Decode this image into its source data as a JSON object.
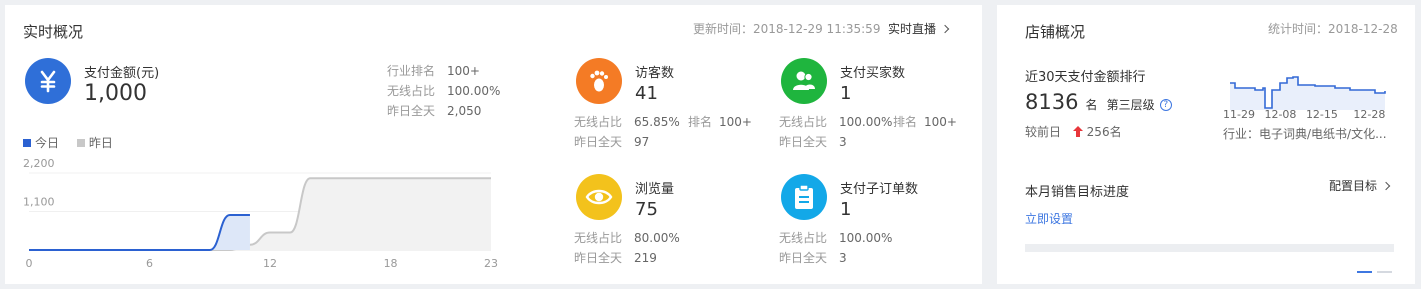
{
  "realtime": {
    "title": "实时概况",
    "update_time": "更新时间：2018-12-29 11:35:59",
    "live_link": "实时直播",
    "payment": {
      "label": "支付金额(元)",
      "value": "1,000",
      "icon": "yuan-icon",
      "color": "#2f6fd8",
      "stats": [
        {
          "label": "行业排名",
          "value": "100+"
        },
        {
          "label": "无线占比",
          "value": "100.00%"
        },
        {
          "label": "昨日全天",
          "value": "2,050"
        }
      ]
    },
    "legend": {
      "today": "今日",
      "yesterday": "昨日",
      "today_color": "#2b61d1",
      "yesterday_color": "#c8c8c8"
    },
    "chart_data": {
      "type": "line",
      "x": [
        0,
        1,
        2,
        3,
        4,
        5,
        6,
        7,
        8,
        9,
        10,
        11,
        12,
        13,
        14,
        15,
        16,
        17,
        18,
        19,
        20,
        21,
        22,
        23
      ],
      "series": [
        {
          "name": "今日",
          "values": [
            0,
            0,
            0,
            0,
            0,
            0,
            0,
            0,
            0,
            0,
            1000,
            1000
          ]
        },
        {
          "name": "昨日",
          "values": [
            0,
            0,
            0,
            0,
            0,
            0,
            0,
            0,
            0,
            0,
            0,
            150,
            500,
            500,
            2050,
            2050,
            2050,
            2050,
            2050,
            2050,
            2050,
            2050,
            2050,
            2050
          ]
        }
      ],
      "yticks": [
        "2,200",
        "1,100"
      ],
      "xticks": [
        "0",
        "6",
        "12",
        "18",
        "23"
      ],
      "ylim": [
        0,
        2200
      ],
      "xlim": [
        0,
        23
      ]
    },
    "visitors": {
      "label": "访客数",
      "value": "41",
      "icon": "footprint-icon",
      "color": "#f47b25",
      "row1": {
        "l1": "无线占比",
        "v1": "65.85%",
        "l2": "排名",
        "v2": "100+"
      },
      "row2": {
        "l1": "昨日全天",
        "v1": "97"
      }
    },
    "buyers": {
      "label": "支付买家数",
      "value": "1",
      "icon": "users-icon",
      "color": "#1fb53e",
      "row1": {
        "l1": "无线占比",
        "v1": "100.00%",
        "l2": "排名",
        "v2": "100+"
      },
      "row2": {
        "l1": "昨日全天",
        "v1": "3"
      }
    },
    "pageviews": {
      "label": "浏览量",
      "value": "75",
      "icon": "eye-icon",
      "color": "#f3c21c",
      "row1": {
        "l1": "无线占比",
        "v1": "80.00%"
      },
      "row2": {
        "l1": "昨日全天",
        "v1": "219"
      }
    },
    "suborders": {
      "label": "支付子订单数",
      "value": "1",
      "icon": "clipboard-icon",
      "color": "#13a8e8",
      "row1": {
        "l1": "无线占比",
        "v1": "100.00%"
      },
      "row2": {
        "l1": "昨日全天",
        "v1": "3"
      }
    }
  },
  "store": {
    "title": "店铺概况",
    "stat_time": "统计时间：2018-12-28",
    "rank_title": "近30天支付金额排行",
    "rank_value": "8136",
    "rank_unit": "名",
    "tier": "第三层级",
    "compare_label": "较前日",
    "compare_value": "256名",
    "industry": "行业：电子词典/电纸书/文化...",
    "spark_xticks": [
      "11-29",
      "12-08",
      "12-15",
      "12-28"
    ],
    "goal_title": "本月销售目标进度",
    "goal_config": "配置目标",
    "goal_setup": "立即设置",
    "up_color": "#e8363b"
  }
}
